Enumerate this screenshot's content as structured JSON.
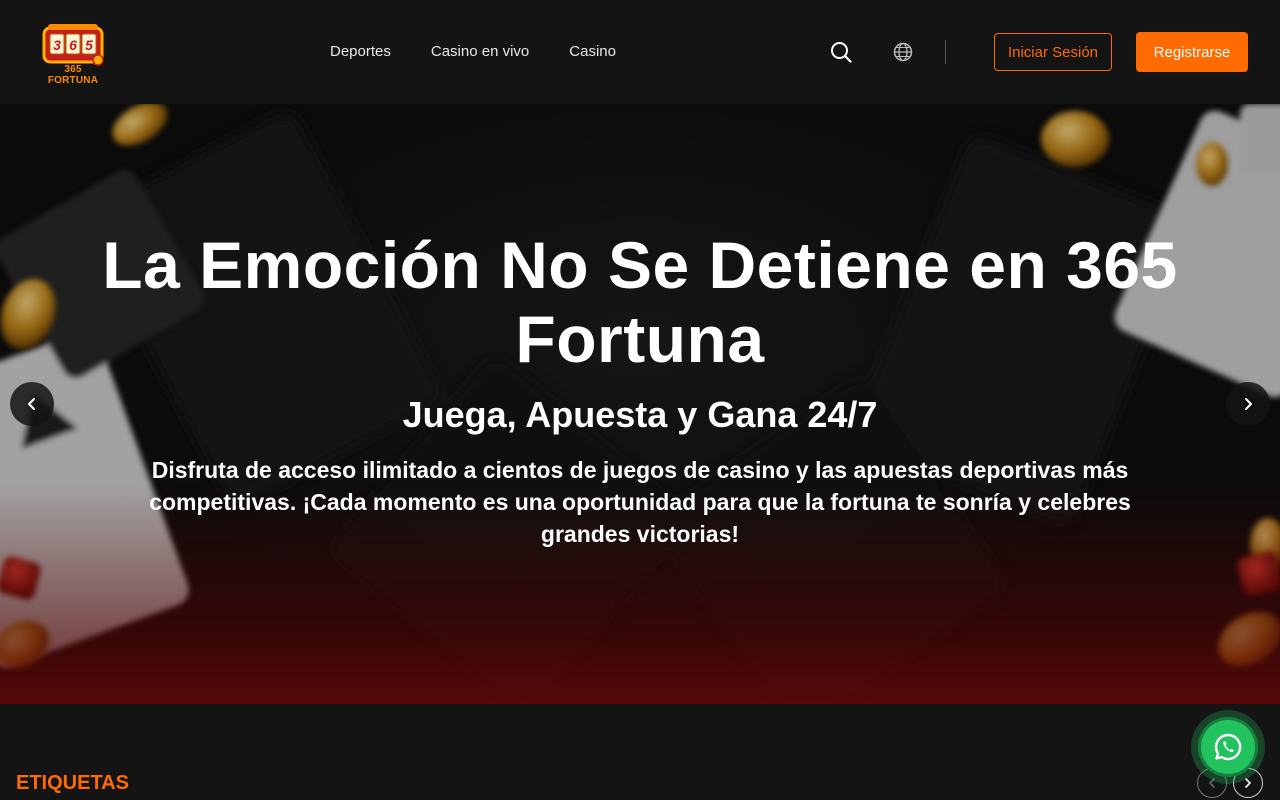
{
  "brand": {
    "logo_digits": "365",
    "logo_name": "365 FORTUNA",
    "accent": "#ff6b00"
  },
  "nav": {
    "items": [
      {
        "label": "Deportes"
      },
      {
        "label": "Casino en vivo"
      },
      {
        "label": "Casino"
      }
    ]
  },
  "header": {
    "search_icon": "search-icon",
    "language_icon": "globe-icon",
    "login_label": "Iniciar Sesión",
    "register_label": "Registrarse"
  },
  "hero": {
    "title": "La Emoción No Se Detiene en 365 Fortuna",
    "subtitle": "Juega, Apuesta y Gana 24/7",
    "description": "Disfruta de acceso ilimitado a cientos de juegos de casino y las apuestas deportivas más competitivas. ¡Cada momento es una oportunidad para que la fortuna te sonría y celebres grandes victorias!",
    "prev_icon": "chevron-left-icon",
    "next_icon": "chevron-right-icon"
  },
  "tags": {
    "heading": "ETIQUETAS"
  },
  "floating": {
    "whatsapp_icon": "whatsapp-icon",
    "whatsapp_color": "#22c35e"
  }
}
